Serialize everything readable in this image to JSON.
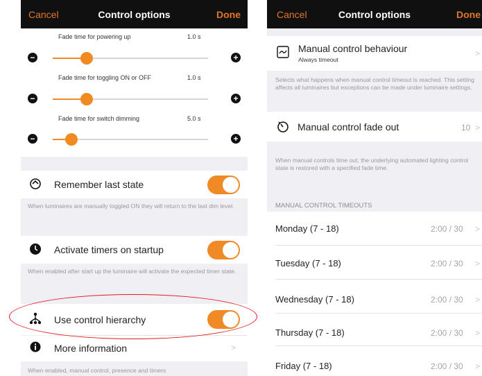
{
  "left": {
    "nav": {
      "cancel": "Cancel",
      "title": "Control options",
      "done": "Done"
    },
    "sliders": [
      {
        "label": "Fade time for powering up",
        "value": "1.0 s",
        "level": 0.22
      },
      {
        "label": "Fade time for toggling ON or OFF",
        "value": "1.0 s",
        "level": 0.22
      },
      {
        "label": "Fade time for switch dimming",
        "value": "5.0 s",
        "level": 0.12
      }
    ],
    "remember": {
      "label": "Remember last state",
      "on": true,
      "desc": "When luminaires are manually toggled ON they will return to the last dim level."
    },
    "activate": {
      "label": "Activate timers on startup",
      "on": true,
      "desc": "When enabled after start up the luminaire will activate the expected timer state."
    },
    "hierarchy": {
      "label": "Use control hierarchy",
      "on": true
    },
    "more": {
      "label": "More information"
    },
    "bottom_desc": "When enabled, manual control, presence and timers"
  },
  "right": {
    "nav": {
      "cancel": "Cancel",
      "title": "Control options",
      "done": "Done"
    },
    "behaviour": {
      "label": "Manual control behaviour",
      "sub": "Always timeout",
      "desc": "Selects what happens when manual control timeout is reached. This setting affects all luminaires but exceptions can be made under luminaire settings."
    },
    "fadeout": {
      "label": "Manual control fade out",
      "value": "10",
      "desc": "When manual controls time out, the underlying automated lighting control state is restored with a specified fade time."
    },
    "section_header": "MANUAL CONTROL TIMEOUTS",
    "days": [
      {
        "label": "Monday (7 - 18)",
        "value": "2:00 / 30"
      },
      {
        "label": "Tuesday (7 - 18)",
        "value": "2:00 / 30"
      },
      {
        "label": "Wednesday (7 - 18)",
        "value": "2:00 / 30"
      },
      {
        "label": "Thursday (7 - 18)",
        "value": "2:00 / 30"
      },
      {
        "label": "Friday (7 - 18)",
        "value": "2:00 / 30"
      }
    ]
  },
  "colors": {
    "accent": "#f08a26",
    "navbar": "#101010",
    "annotation": "#e3171c",
    "background": "#efeff4"
  }
}
